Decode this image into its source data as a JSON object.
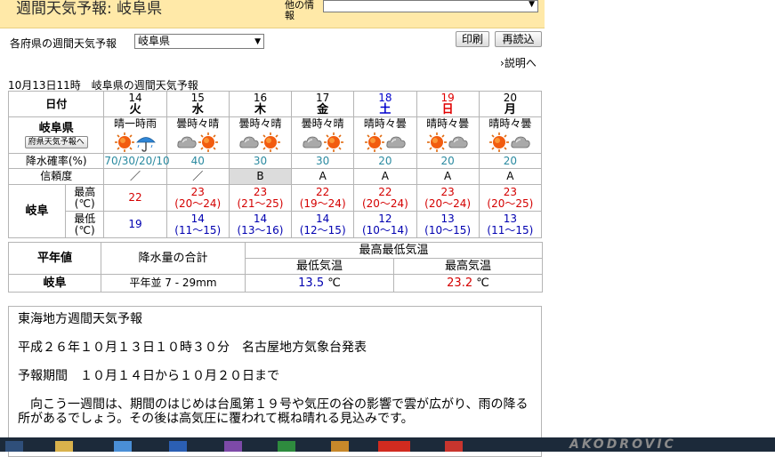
{
  "header": {
    "title": "週間天気予報: 岐阜県",
    "other_info_label": "他の情報",
    "other_select_value": ""
  },
  "selector": {
    "label": "各府県の週間天気予報",
    "value": "岐阜県"
  },
  "buttons": {
    "print": "印刷",
    "reload": "再読込"
  },
  "explain_link": "説明へ",
  "issued": "10月13日11時　岐阜県の週間天気予報",
  "table": {
    "date_header": "日付",
    "days": [
      {
        "num": "14",
        "wk": "火",
        "cls": ""
      },
      {
        "num": "15",
        "wk": "水",
        "cls": ""
      },
      {
        "num": "16",
        "wk": "木",
        "cls": ""
      },
      {
        "num": "17",
        "wk": "金",
        "cls": ""
      },
      {
        "num": "18",
        "wk": "土",
        "cls": "sat"
      },
      {
        "num": "19",
        "wk": "日",
        "cls": "sun"
      },
      {
        "num": "20",
        "wk": "月",
        "cls": ""
      }
    ],
    "area_name": "岐阜県",
    "area_button": "府県天気予報へ",
    "weather": [
      {
        "text": "晴一時雨",
        "icons": [
          "sun",
          "umbrella"
        ]
      },
      {
        "text": "曇時々晴",
        "icons": [
          "cloud",
          "sun"
        ]
      },
      {
        "text": "曇時々晴",
        "icons": [
          "cloud",
          "sun"
        ]
      },
      {
        "text": "曇時々晴",
        "icons": [
          "cloud",
          "sun"
        ]
      },
      {
        "text": "晴時々曇",
        "icons": [
          "sun",
          "cloud"
        ]
      },
      {
        "text": "晴時々曇",
        "icons": [
          "sun",
          "cloud"
        ]
      },
      {
        "text": "晴時々曇",
        "icons": [
          "sun",
          "cloud"
        ]
      }
    ],
    "rain_label": "降水確率(%)",
    "rain": [
      "70/30/20/10",
      "40",
      "30",
      "30",
      "20",
      "20",
      "20"
    ],
    "reliability_label": "信頼度",
    "reliability": [
      "／",
      "／",
      "B",
      "A",
      "A",
      "A",
      "A"
    ],
    "city": "岐阜",
    "max_label": "最高(℃)",
    "min_label": "最低(℃)",
    "max": [
      {
        "v": "22",
        "r": ""
      },
      {
        "v": "23",
        "r": "(20～24)"
      },
      {
        "v": "23",
        "r": "(21～25)"
      },
      {
        "v": "22",
        "r": "(19～24)"
      },
      {
        "v": "22",
        "r": "(20～24)"
      },
      {
        "v": "23",
        "r": "(20～24)"
      },
      {
        "v": "23",
        "r": "(20～25)"
      }
    ],
    "min": [
      {
        "v": "19",
        "r": ""
      },
      {
        "v": "14",
        "r": "(11～15)"
      },
      {
        "v": "14",
        "r": "(13～16)"
      },
      {
        "v": "14",
        "r": "(12～15)"
      },
      {
        "v": "12",
        "r": "(10～14)"
      },
      {
        "v": "13",
        "r": "(10～15)"
      },
      {
        "v": "13",
        "r": "(11～15)"
      }
    ]
  },
  "normals": {
    "label": "平年値",
    "precip_header": "降水量の合計",
    "temp_header": "最高最低気温",
    "min_header": "最低気温",
    "max_header": "最高気温",
    "city": "岐阜",
    "precip": "平年並 7 - 29mm",
    "min_val": "13.5",
    "max_val": "23.2",
    "unit": "℃"
  },
  "forecast": {
    "title": "東海地方週間天気予報",
    "issued": "平成２６年１０月１３日１０時３０分　名古屋地方気象台発表",
    "period": "予報期間　１０月１４日から１０月２０日まで",
    "body": "　向こう一週間は、期間のはじめは台風第１９号や気圧の谷の影響で雲が広がり、雨の降る所があるでしょう。その後は高気圧に覆われて概ね晴れる見込みです。"
  },
  "watermark": "AKODROVIC",
  "colors": {
    "header_bg": "#ffe9a8",
    "max_temp": "#d40000",
    "min_temp": "#0000b0",
    "rain": "#2a8aa0"
  }
}
